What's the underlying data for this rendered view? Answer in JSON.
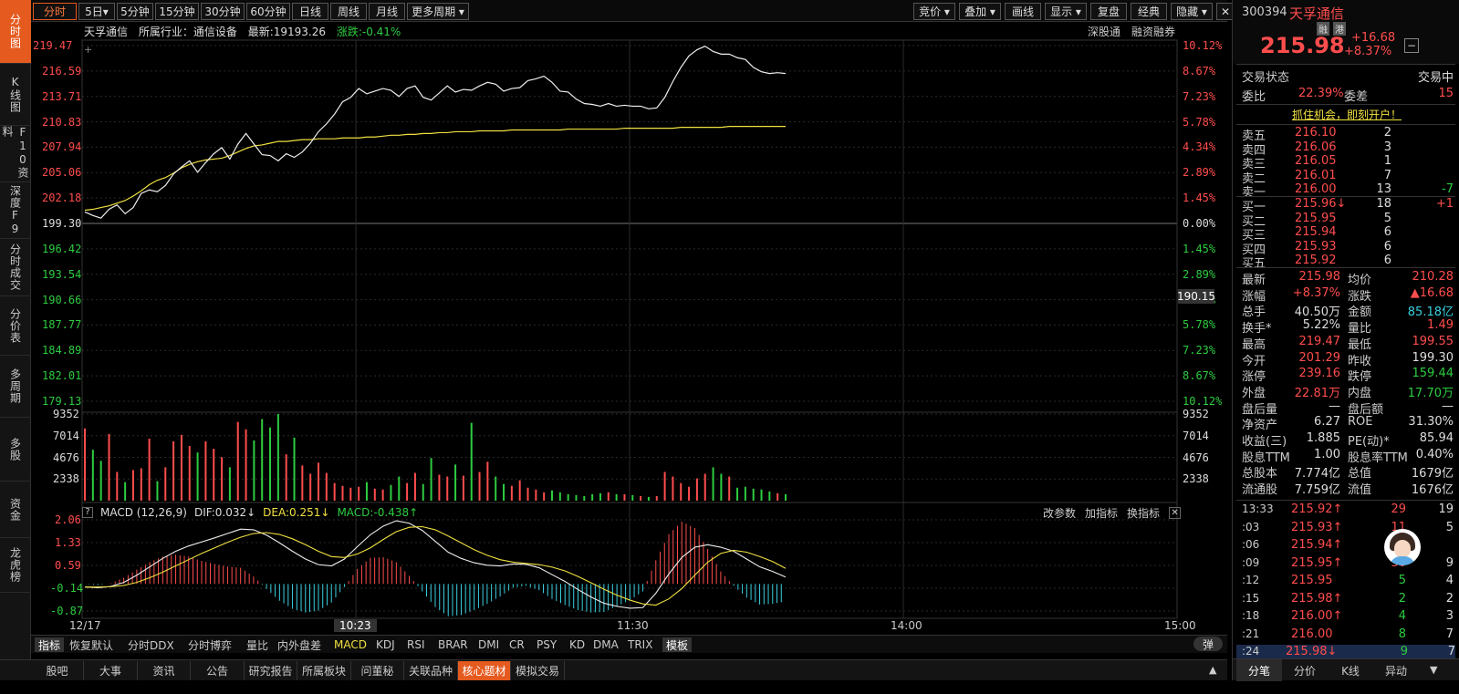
{
  "left_nav": [
    "分时图",
    "K线图",
    "F10资料",
    "深度F9",
    "分时成交",
    "分价表",
    "多周期",
    "多股",
    "资金",
    "龙虎榜"
  ],
  "top_tabs": [
    "分时",
    "5日▾",
    "5分钟",
    "15分钟",
    "30分钟",
    "60分钟",
    "日线",
    "周线",
    "月线",
    "更多周期 ▾"
  ],
  "top_right_tabs": [
    "竞价 ▾",
    "叠加 ▾",
    "画线",
    "显示 ▾",
    "复盘",
    "经典",
    "隐藏 ▾",
    "✕"
  ],
  "info_bar": {
    "name": "天孚通信",
    "industry": "所属行业：通信设备",
    "latest": "最新:19193.26",
    "change": "涨跌:-0.41%",
    "tag1": "深股通",
    "tag2": "融资融券"
  },
  "price_axis_left": [
    "219.47",
    "216.59",
    "213.71",
    "210.83",
    "207.94",
    "205.06",
    "202.18",
    "199.30",
    "196.42",
    "193.54",
    "190.66",
    "187.77",
    "184.89",
    "182.01",
    "179.13"
  ],
  "price_axis_right": [
    "10.12%",
    "8.67%",
    "7.23%",
    "5.78%",
    "4.34%",
    "2.89%",
    "1.45%",
    "0.00%",
    "1.45%",
    "2.89%",
    "4.34%",
    "5.78%",
    "7.23%",
    "8.67%",
    "10.12%"
  ],
  "cursor_price": "190.15",
  "vol_axis": [
    "9352",
    "7014",
    "4676",
    "2338"
  ],
  "macd_header": {
    "name": "MACD (12,26,9)",
    "dif": "DIF:0.032↓",
    "dea": "DEA:0.251↓",
    "macd": "MACD:-0.438↑",
    "btn1": "改参数",
    "btn2": "加指标",
    "btn3": "换指标"
  },
  "macd_axis": [
    "2.06",
    "1.33",
    "0.59",
    "-0.14",
    "-0.87"
  ],
  "time_axis": [
    "12/17",
    "10:23",
    "11:30",
    "14:00",
    "15:00"
  ],
  "indicator_tabs": [
    "指标",
    "恢复默认",
    "分时DDX",
    "分时博弈",
    "量比",
    "内外盘差",
    "MACD",
    "KDJ",
    "RSI",
    "BRAR",
    "DMI",
    "CR",
    "PSY",
    "KD",
    "DMA",
    "TRIX",
    "模板"
  ],
  "popup_btn": "弹",
  "bottom_tabs": [
    "股吧",
    "大事",
    "资讯",
    "公告",
    "研究报告",
    "所属板块",
    "问董秘",
    "关联品种",
    "核心题材",
    "模拟交易"
  ],
  "stock": {
    "code": "300394",
    "name": "天孚通信",
    "tag1": "融",
    "tag2": "港",
    "price": "215.98",
    "chg": "+16.68",
    "pct": "+8.37%"
  },
  "status": {
    "label": "交易状态",
    "value": "交易中"
  },
  "weibi": {
    "l1": "委比",
    "v1": "22.39%",
    "l2": "委差",
    "v2": "15"
  },
  "promo": "抓住机会，即刻开户！",
  "sell": [
    [
      "卖五",
      "216.10",
      "2",
      ""
    ],
    [
      "卖四",
      "216.06",
      "3",
      ""
    ],
    [
      "卖三",
      "216.05",
      "1",
      ""
    ],
    [
      "卖二",
      "216.01",
      "7",
      ""
    ],
    [
      "卖一",
      "216.00",
      "13",
      "-7"
    ]
  ],
  "buy": [
    [
      "买一",
      "215.96↓",
      "18",
      "+1"
    ],
    [
      "买二",
      "215.95",
      "5",
      ""
    ],
    [
      "买三",
      "215.94",
      "6",
      ""
    ],
    [
      "买四",
      "215.93",
      "6",
      ""
    ],
    [
      "买五",
      "215.92",
      "6",
      ""
    ]
  ],
  "stats": [
    [
      "最新",
      "215.98",
      "均价",
      "210.28"
    ],
    [
      "涨幅",
      "+8.37%",
      "涨跌",
      "▲16.68"
    ],
    [
      "总手",
      "40.50万",
      "金额",
      "85.18亿"
    ],
    [
      "换手*",
      "5.22%",
      "量比",
      "1.49"
    ],
    [
      "最高",
      "219.47",
      "最低",
      "199.55"
    ],
    [
      "今开",
      "201.29",
      "昨收",
      "199.30"
    ],
    [
      "涨停",
      "239.16",
      "跌停",
      "159.44"
    ],
    [
      "外盘",
      "22.81万",
      "内盘",
      "17.70万"
    ],
    [
      "盘后量",
      "—",
      "盘后额",
      "—"
    ],
    [
      "净资产",
      "6.27",
      "ROE",
      "31.30%"
    ],
    [
      "收益(三)",
      "1.885",
      "PE(动)*",
      "85.94"
    ],
    [
      "股息TTM",
      "1.00",
      "股息率TTM",
      "0.40%"
    ],
    [
      "总股本",
      "7.774亿",
      "总值",
      "1679亿"
    ],
    [
      "流通股",
      "7.759亿",
      "流值",
      "1676亿"
    ]
  ],
  "ticks": [
    [
      "13:33",
      "215.92↑",
      "29",
      "19"
    ],
    [
      ":03",
      "215.93↑",
      "11",
      "5"
    ],
    [
      ":06",
      "215.94↑",
      "",
      ""
    ],
    [
      ":09",
      "215.95↑",
      "30",
      "9"
    ],
    [
      ":12",
      "215.95",
      "5",
      "4"
    ],
    [
      ":15",
      "215.98↑",
      "2",
      "2"
    ],
    [
      ":18",
      "216.00↑",
      "4",
      "3"
    ],
    [
      ":21",
      "216.00",
      "8",
      "7"
    ],
    [
      ":24",
      "215.98↓",
      "9",
      "7"
    ]
  ],
  "right_tabs": [
    "分笔",
    "分价",
    "K线",
    "异动"
  ],
  "colors": {
    "up": "#ff4d4d",
    "down": "#2ecc40",
    "accent": "#e55a1f",
    "avg": "#f0e040",
    "macd_neg": "#3ad0e0"
  },
  "chart_data": {
    "type": "line",
    "price": [
      200.6,
      200.2,
      199.9,
      200.9,
      201.4,
      200.4,
      201.1,
      202.7,
      203.1,
      202.9,
      203.6,
      204.9,
      205.7,
      206.4,
      205.1,
      206.2,
      207.2,
      207.9,
      206.6,
      208.3,
      209.5,
      208.3,
      207.1,
      207.0,
      206.4,
      207.2,
      206.8,
      207.4,
      208.4,
      209.7,
      210.6,
      211.7,
      213.1,
      213.6,
      214.6,
      214.0,
      214.3,
      214.6,
      214.4,
      213.7,
      214.6,
      214.9,
      213.6,
      213.3,
      214.1,
      214.9,
      214.2,
      214.5,
      214.4,
      214.9,
      215.3,
      215.1,
      214.3,
      214.6,
      214.7,
      215.5,
      215.7,
      216.0,
      215.3,
      214.3,
      214.2,
      213.4,
      212.9,
      212.8,
      212.6,
      212.9,
      212.6,
      212.7,
      212.6,
      212.6,
      212.3,
      212.4,
      213.6,
      215.4,
      217.0,
      218.3,
      219.0,
      219.4,
      218.8,
      218.5,
      218.5,
      218.1,
      217.9,
      217.0,
      216.5,
      216.3,
      216.4,
      216.3
    ],
    "avg": [
      200.8,
      200.9,
      201.1,
      201.3,
      201.6,
      201.9,
      202.4,
      203.0,
      203.7,
      204.2,
      204.5,
      205.0,
      205.6,
      206.0,
      206.3,
      206.5,
      206.6,
      206.7,
      207.0,
      207.4,
      207.8,
      208.1,
      208.2,
      208.4,
      208.6,
      208.6,
      208.7,
      208.8,
      208.8,
      208.9,
      208.9,
      208.9,
      209.0,
      209.0,
      209.0,
      209.1,
      209.1,
      209.2,
      209.3,
      209.3,
      209.4,
      209.4,
      209.5,
      209.5,
      209.6,
      209.6,
      209.7,
      209.7,
      209.7,
      209.8,
      209.8,
      209.8,
      209.8,
      209.9,
      209.9,
      209.9,
      209.9,
      209.9,
      209.9,
      209.9,
      210.0,
      210.0,
      210.0,
      210.0,
      210.0,
      210.0,
      210.0,
      210.1,
      210.1,
      210.1,
      210.1,
      210.1,
      210.1,
      210.1,
      210.2,
      210.2,
      210.2,
      210.2,
      210.2,
      210.2,
      210.3,
      210.3,
      210.3,
      210.3,
      210.3,
      210.3,
      210.3,
      210.3
    ],
    "volume": [
      7800,
      5500,
      4300,
      7200,
      3100,
      2000,
      3300,
      3500,
      6700,
      2100,
      3600,
      6400,
      7100,
      5900,
      5200,
      6400,
      5600,
      4700,
      3600,
      8500,
      7700,
      6500,
      8800,
      7900,
      9352,
      5000,
      6800,
      3800,
      2900,
      4100,
      3000,
      1900,
      1600,
      1400,
      1500,
      2000,
      1300,
      1200,
      1700,
      2600,
      1900,
      3000,
      1800,
      4600,
      2800,
      2600,
      3900,
      2700,
      8400,
      3100,
      4200,
      2600,
      1800,
      1600,
      2200,
      1400,
      1200,
      900,
      1100,
      900,
      700,
      600,
      500,
      700,
      800,
      900,
      700,
      700,
      600,
      500,
      400,
      500,
      3100,
      2600,
      1900,
      1500,
      2400,
      2900,
      3600,
      2900,
      2600,
      1400,
      1500,
      1300,
      1200,
      1000,
      800,
      700
    ],
    "macd_dif": [
      -0.1,
      -0.12,
      -0.08,
      0.05,
      0.28,
      0.55,
      0.82,
      1.05,
      1.22,
      1.35,
      1.48,
      1.62,
      1.76,
      1.74,
      1.57,
      1.32,
      1.05,
      0.8,
      0.62,
      0.58,
      0.8,
      1.2,
      1.58,
      1.86,
      2.03,
      1.95,
      1.72,
      1.37,
      1.02,
      0.82,
      0.68,
      0.6,
      0.58,
      0.64,
      0.63,
      0.52,
      0.3,
      0.08,
      -0.18,
      -0.42,
      -0.62,
      -0.72,
      -0.78,
      -0.76,
      -0.3,
      0.32,
      0.85,
      1.18,
      1.26,
      1.18,
      1.05,
      0.8,
      0.55,
      0.4,
      0.22
    ],
    "macd_dea": [
      -0.1,
      -0.1,
      -0.09,
      -0.05,
      0.05,
      0.2,
      0.38,
      0.58,
      0.78,
      0.98,
      1.16,
      1.34,
      1.5,
      1.62,
      1.65,
      1.59,
      1.45,
      1.26,
      1.05,
      0.88,
      0.85,
      0.96,
      1.16,
      1.43,
      1.68,
      1.82,
      1.84,
      1.74,
      1.54,
      1.32,
      1.1,
      0.92,
      0.78,
      0.7,
      0.66,
      0.62,
      0.54,
      0.42,
      0.24,
      0.04,
      -0.17,
      -0.36,
      -0.52,
      -0.64,
      -0.68,
      -0.48,
      -0.15,
      0.28,
      0.7,
      0.98,
      1.08,
      1.02,
      0.88,
      0.72,
      0.5
    ]
  }
}
